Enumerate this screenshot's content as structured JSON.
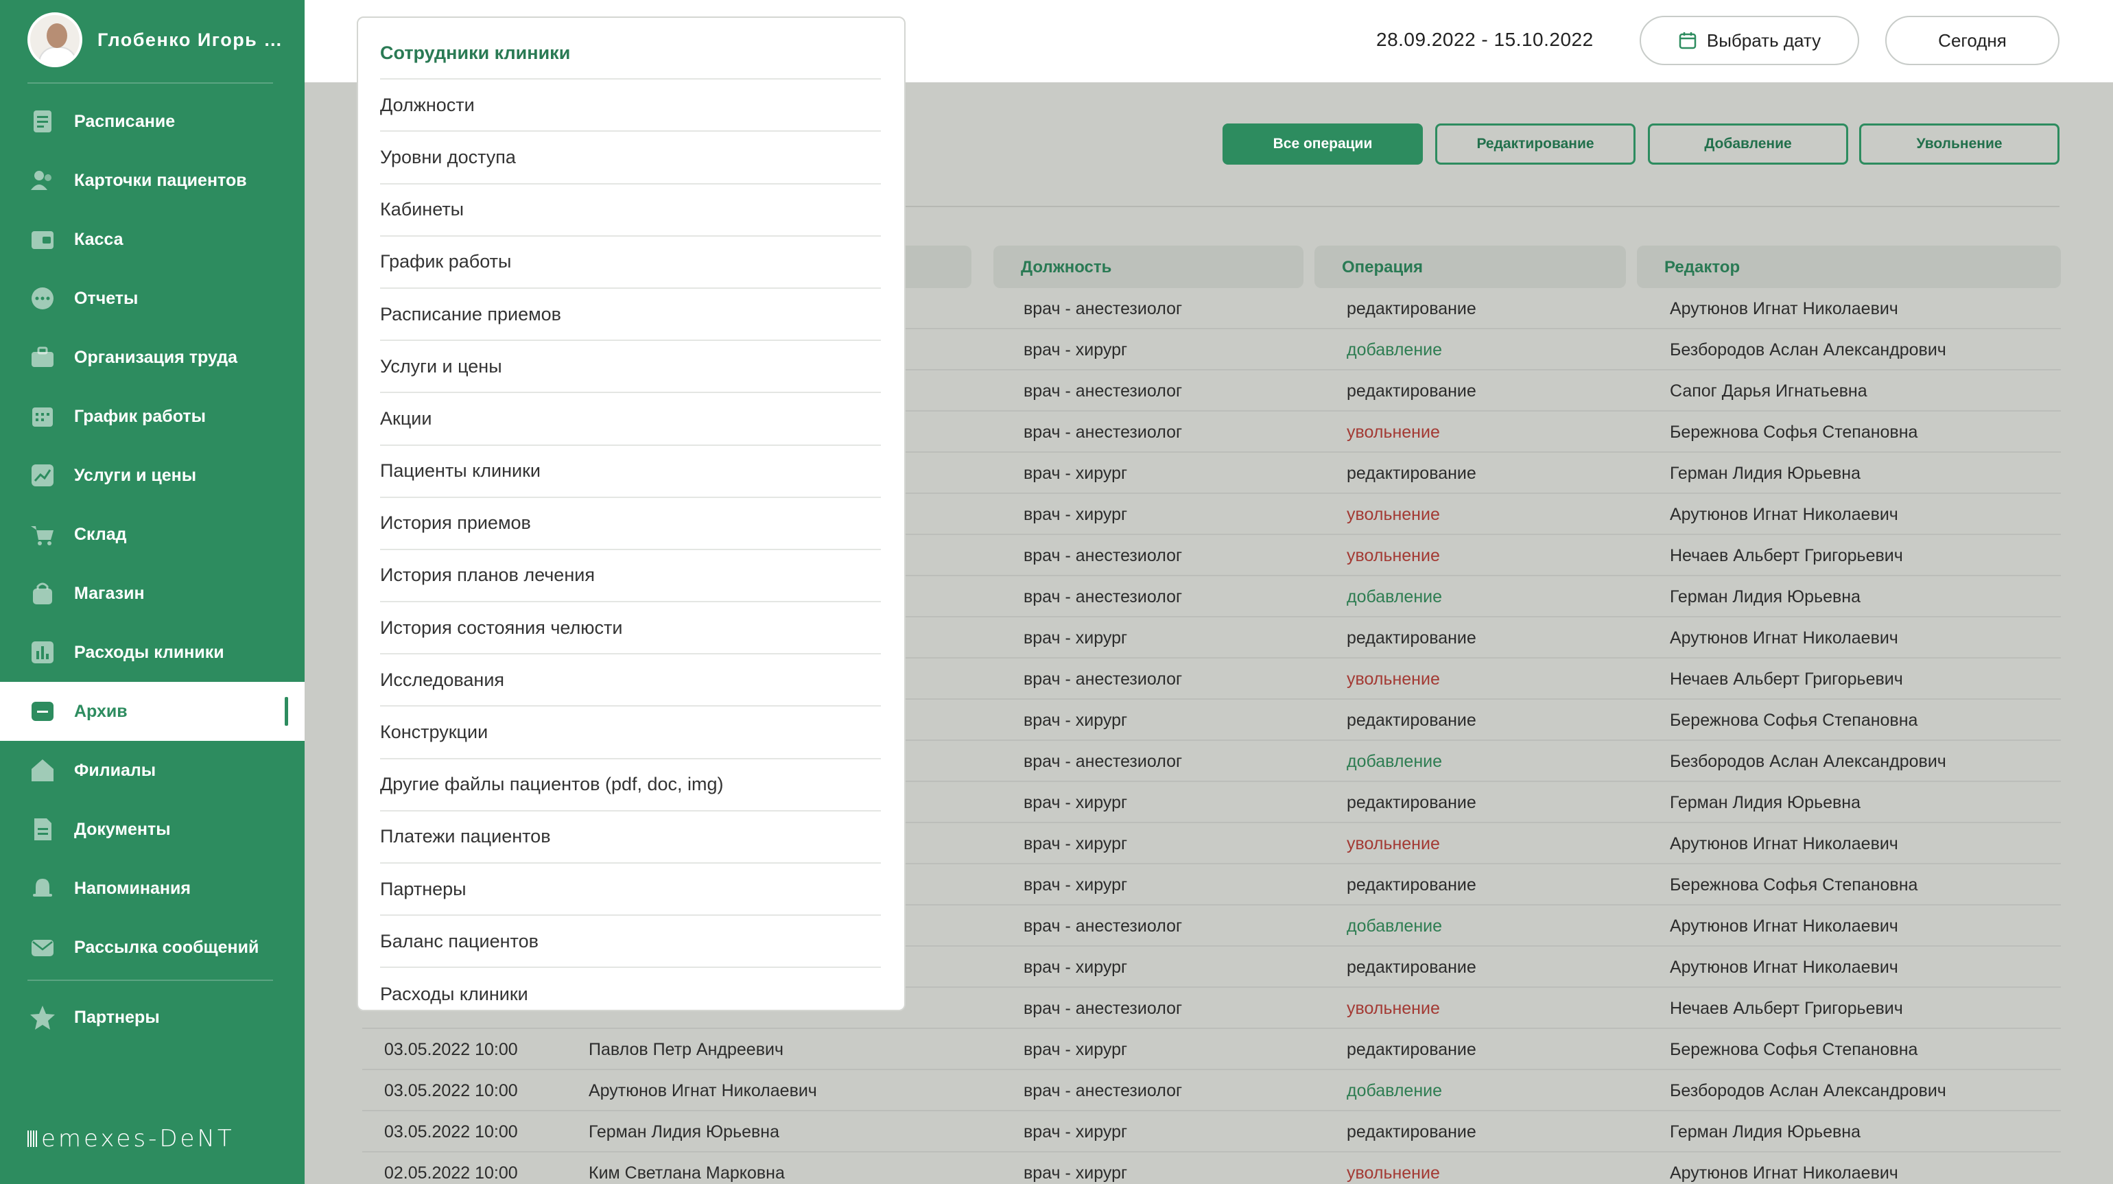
{
  "user": {
    "name": "Глобенко Игорь А..."
  },
  "nav": [
    {
      "label": "Расписание",
      "icon": "calendar-doc-icon"
    },
    {
      "label": "Карточки пациентов",
      "icon": "patients-icon"
    },
    {
      "label": "Касса",
      "icon": "cash-register-icon"
    },
    {
      "label": "Отчеты",
      "icon": "reports-icon"
    },
    {
      "label": "Организация труда",
      "icon": "briefcase-icon"
    },
    {
      "label": "График работы",
      "icon": "work-calendar-icon"
    },
    {
      "label": "Услуги и цены",
      "icon": "chart-up-icon"
    },
    {
      "label": "Склад",
      "icon": "cart-icon"
    },
    {
      "label": "Магазин",
      "icon": "shop-bag-icon"
    },
    {
      "label": "Расходы клиники",
      "icon": "bar-chart-icon"
    },
    {
      "label": "Архив",
      "icon": "archive-icon"
    },
    {
      "label": "Филиалы",
      "icon": "home-icon"
    },
    {
      "label": "Документы",
      "icon": "document-icon"
    },
    {
      "label": "Напоминания",
      "icon": "bell-icon"
    },
    {
      "label": "Рассылка сообщений",
      "icon": "mail-icon"
    }
  ],
  "partners": {
    "label": "Партнеры",
    "icon": "star-icon"
  },
  "brand": "emexes-DeNT",
  "header": {
    "date_range": "28.09.2022 - 15.10.2022",
    "pick_date": "Выбрать дату",
    "today": "Сегодня"
  },
  "filters": [
    "Все операции",
    "Редактирование",
    "Добавление",
    "Увольнение"
  ],
  "columns": [
    "Должность",
    "Операция",
    "Редактор"
  ],
  "rows": [
    {
      "date": "",
      "name": "",
      "position": "врач - анестезиолог",
      "operation": "редактирование",
      "op": "edit",
      "editor": "Арутюнов Игнат Николаевич"
    },
    {
      "date": "",
      "name": "",
      "position": "врач - хирург",
      "operation": "добавление",
      "op": "add",
      "editor": "Безбородов Аслан Александрович"
    },
    {
      "date": "",
      "name": "",
      "position": "врач - анестезиолог",
      "operation": "редактирование",
      "op": "edit",
      "editor": "Сапог Дарья Игнатьевна"
    },
    {
      "date": "",
      "name": "",
      "position": "врач - анестезиолог",
      "operation": "увольнение",
      "op": "fire",
      "editor": "Бережнова Софья Степановна"
    },
    {
      "date": "",
      "name": "",
      "position": "врач - хирург",
      "operation": "редактирование",
      "op": "edit",
      "editor": "Герман Лидия Юрьевна"
    },
    {
      "date": "",
      "name": "",
      "position": "врач - хирург",
      "operation": "увольнение",
      "op": "fire",
      "editor": "Арутюнов Игнат Николаевич"
    },
    {
      "date": "",
      "name": "",
      "position": "врач - анестезиолог",
      "operation": "увольнение",
      "op": "fire",
      "editor": "Нечаев Альберт Григорьевич"
    },
    {
      "date": "",
      "name": "",
      "position": "врач - анестезиолог",
      "operation": "добавление",
      "op": "add",
      "editor": "Герман Лидия Юрьевна"
    },
    {
      "date": "",
      "name": "",
      "position": "врач - хирург",
      "operation": "редактирование",
      "op": "edit",
      "editor": "Арутюнов Игнат Николаевич"
    },
    {
      "date": "",
      "name": "",
      "position": "врач - анестезиолог",
      "operation": "увольнение",
      "op": "fire",
      "editor": "Нечаев Альберт Григорьевич"
    },
    {
      "date": "",
      "name": "",
      "position": "врач - хирург",
      "operation": "редактирование",
      "op": "edit",
      "editor": "Бережнова Софья Степановна"
    },
    {
      "date": "",
      "name": "",
      "position": "врач - анестезиолог",
      "operation": "добавление",
      "op": "add",
      "editor": "Безбородов Аслан Александрович"
    },
    {
      "date": "",
      "name": "",
      "position": "врач - хирург",
      "operation": "редактирование",
      "op": "edit",
      "editor": "Герман Лидия Юрьевна"
    },
    {
      "date": "",
      "name": "",
      "position": "врач - хирург",
      "operation": "увольнение",
      "op": "fire",
      "editor": "Арутюнов Игнат Николаевич"
    },
    {
      "date": "",
      "name": "",
      "position": "врач - хирург",
      "operation": "редактирование",
      "op": "edit",
      "editor": "Бережнова Софья Степановна"
    },
    {
      "date": "",
      "name": "",
      "position": "врач - анестезиолог",
      "operation": "добавление",
      "op": "add",
      "editor": "Арутюнов Игнат Николаевич"
    },
    {
      "date": "",
      "name": "",
      "position": "врач - хирург",
      "operation": "редактирование",
      "op": "edit",
      "editor": "Арутюнов Игнат Николаевич"
    },
    {
      "date": "",
      "name": "",
      "position": "врач - анестезиолог",
      "operation": "увольнение",
      "op": "fire",
      "editor": "Нечаев Альберт Григорьевич"
    },
    {
      "date": "03.05.2022  10:00",
      "name": "Павлов Петр Андреевич",
      "position": "врач - хирург",
      "operation": "редактирование",
      "op": "edit",
      "editor": "Бережнова Софья Степановна"
    },
    {
      "date": "03.05.2022  10:00",
      "name": "Арутюнов Игнат Николаевич",
      "position": "врач - анестезиолог",
      "operation": "добавление",
      "op": "add",
      "editor": "Безбородов Аслан Александрович"
    },
    {
      "date": "03.05.2022  10:00",
      "name": "Герман Лидия Юрьевна",
      "position": "врач - хирург",
      "operation": "редактирование",
      "op": "edit",
      "editor": "Герман Лидия Юрьевна"
    },
    {
      "date": "02.05.2022  10:00",
      "name": "Ким Светлана Марковна",
      "position": "врач - хирург",
      "operation": "увольнение",
      "op": "fire",
      "editor": "Арутюнов Игнат Николаевич"
    }
  ],
  "dropdown": [
    "Сотрудники клиники",
    "Должности",
    "Уровни доступа",
    "Кабинеты",
    "График работы",
    "Расписание приемов",
    "Услуги и цены",
    "Акции",
    "Пациенты клиники",
    "История приемов",
    "История планов лечения",
    "История состояния челюсти",
    "Исследования",
    "Конструкции",
    "Другие файлы пациентов (pdf, doc, img)",
    "Платежи пациентов",
    "Партнеры",
    "Баланс пациентов",
    "Расходы клиники"
  ],
  "colors": {
    "brand": "#2d8c5f",
    "add": "#2e7d52",
    "fire": "#a33a34"
  }
}
